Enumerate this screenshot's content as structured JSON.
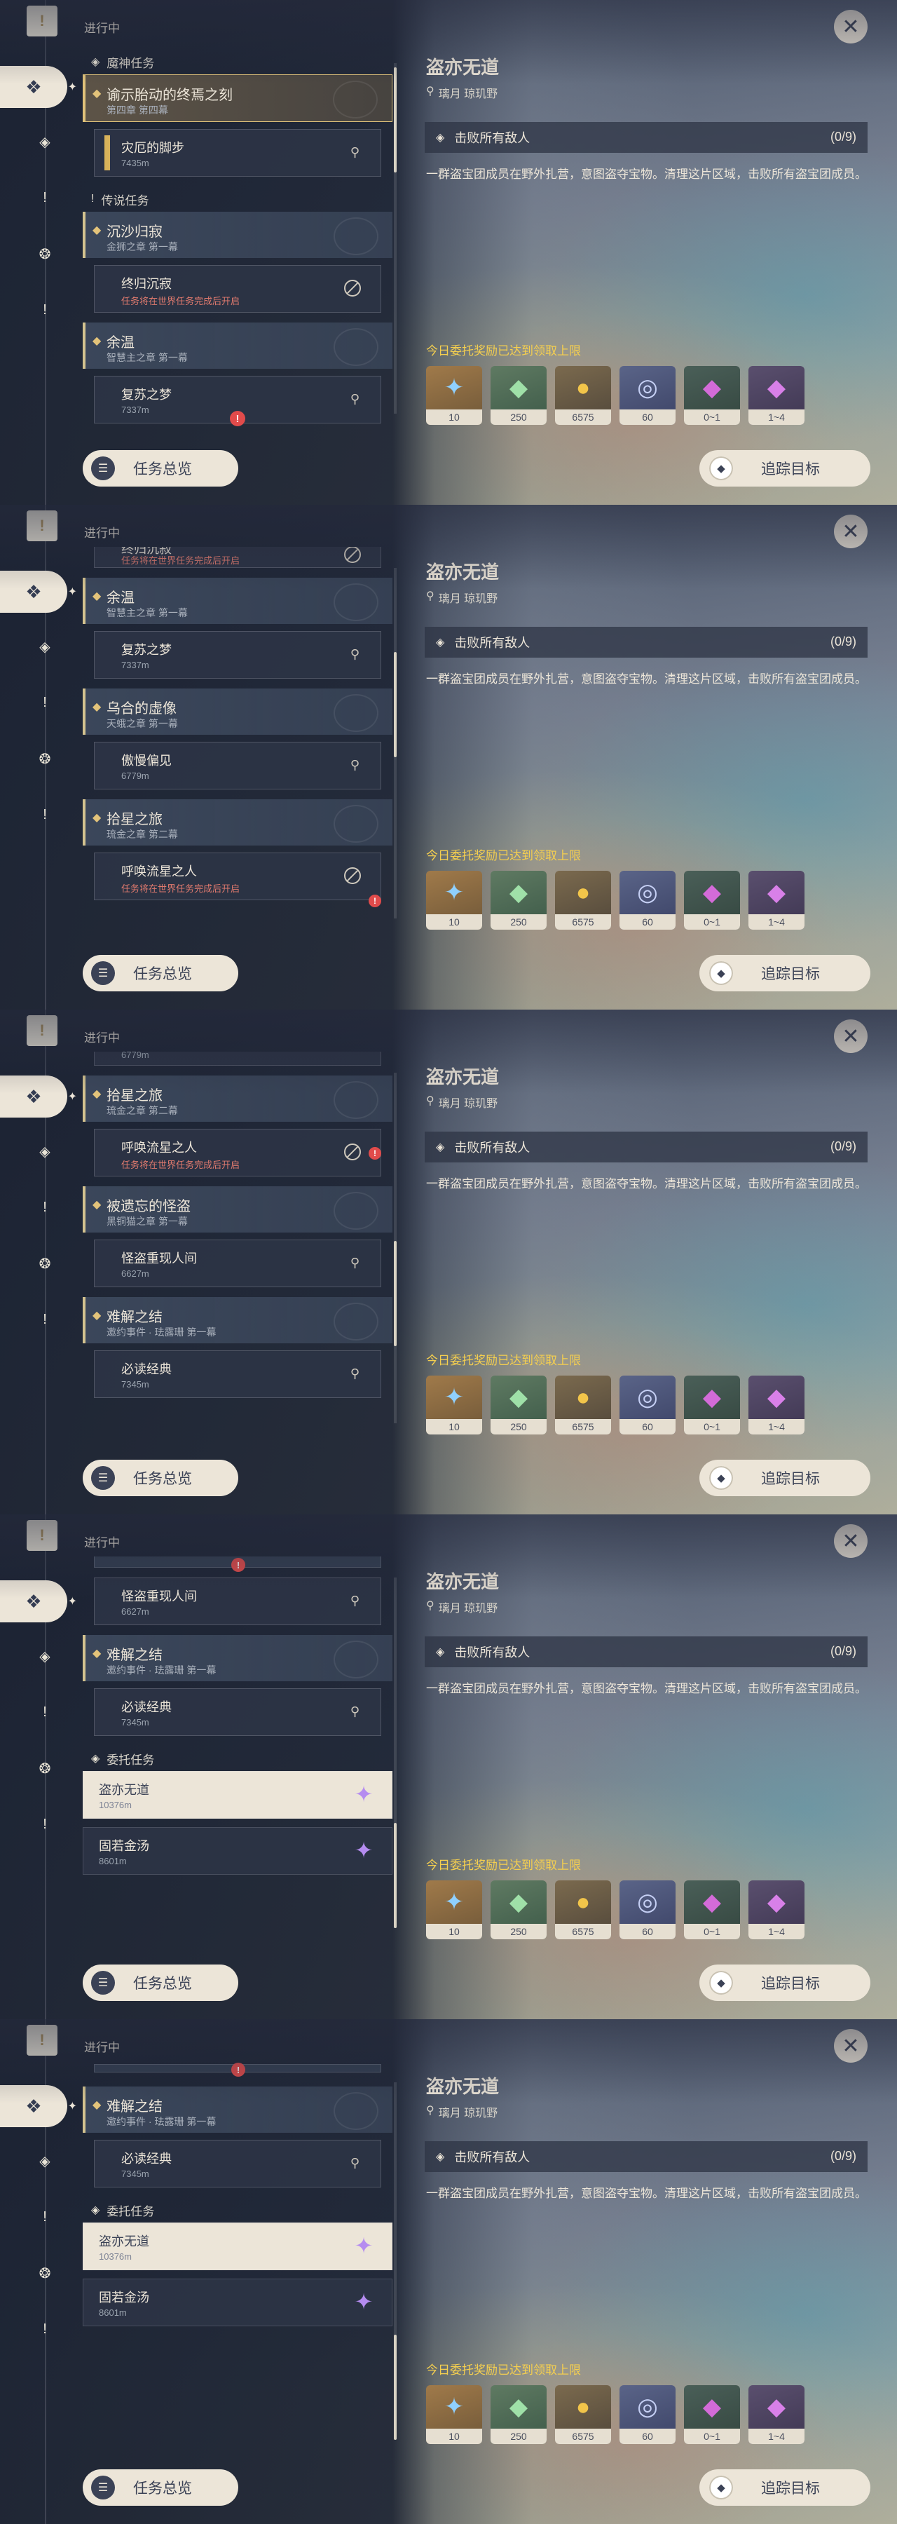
{
  "frames": [
    {
      "status_heading": "进行中",
      "detail": {
        "title": "盗亦无道",
        "location": "璃月 琼玑野",
        "objective": "击败所有敌人",
        "objective_count": "(0/9)",
        "description": "一群盗宝团成员在野外扎营，意图盗夺宝物。清理这片区域，击败所有盗宝团成员。",
        "reward_note": "今日委托奖励已达到领取上限",
        "rewards": [
          "10",
          "250",
          "6575",
          "60",
          "0~1",
          "1~4"
        ]
      },
      "buttons": {
        "overview": "任务总览",
        "track": "追踪目标"
      }
    }
  ],
  "sections": {
    "archon": "魔神任务",
    "legend": "传说任务",
    "commission": "委托任务"
  },
  "quests": {
    "q1": {
      "title": "谕示胎动的终焉之刻",
      "sub": "第四章 第四幕"
    },
    "q1s": {
      "title": "灾厄的脚步",
      "sub": "7435m"
    },
    "q2": {
      "title": "沉沙归寂",
      "sub": "金狮之章 第一幕"
    },
    "q2s": {
      "title": "终归沉寂",
      "sub": "任务将在世界任务完成后开启"
    },
    "q3": {
      "title": "余温",
      "sub": "智慧主之章 第一幕"
    },
    "q3s": {
      "title": "复苏之梦",
      "sub": "7337m"
    },
    "q4": {
      "title": "乌合的虚像",
      "sub": "天蛾之章 第一幕"
    },
    "q4s": {
      "title": "傲慢偏见",
      "sub": "6779m"
    },
    "q5": {
      "title": "拾星之旅",
      "sub": "琉金之章 第二幕"
    },
    "q5s": {
      "title": "呼唤流星之人",
      "sub": "任务将在世界任务完成后开启"
    },
    "q6": {
      "title": "被遗忘的怪盗",
      "sub": "黑铜猫之章 第一幕"
    },
    "q6s": {
      "title": "怪盗重现人间",
      "sub": "6627m"
    },
    "q7": {
      "title": "难解之结",
      "sub": "邀约事件 · 珐露珊 第一幕"
    },
    "q7s": {
      "title": "必读经典",
      "sub": "7345m"
    },
    "c1": {
      "title": "盗亦无道",
      "sub": "10376m"
    },
    "c2": {
      "title": "固若金汤",
      "sub": "8601m"
    }
  },
  "icons": {
    "rail": [
      "bookmark-icon",
      "all-quests-icon",
      "archon-icon",
      "alert-icon",
      "world-icon",
      "exclamation-icon"
    ],
    "reward_art": [
      "✦",
      "◆",
      "●",
      "◎",
      "◆",
      "◆"
    ]
  },
  "colors": {
    "accent_gold": "#e3c37a",
    "reward_note": "#f5cf4f",
    "alert": "#e14b4b",
    "commission_star": "#b58cf0"
  }
}
